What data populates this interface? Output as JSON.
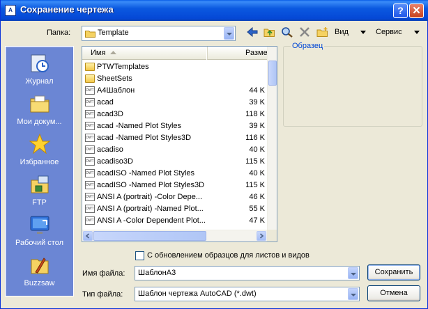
{
  "window": {
    "title": "Сохранение чертежа",
    "app_icon": "autocad-drawing-icon",
    "help_label": "?",
    "close_label": "✕"
  },
  "folder_label": "Папка:",
  "folder_value": "Template",
  "toolbar": {
    "icons": [
      "back-arrow-icon",
      "up-folder-icon",
      "search-web-icon",
      "delete-icon",
      "new-folder-icon"
    ],
    "view_label": "Вид",
    "service_label": "Сервис"
  },
  "places": [
    {
      "label": "Журнал",
      "icon": "history-icon"
    },
    {
      "label": "Мои докум...",
      "icon": "my-documents-icon"
    },
    {
      "label": "Избранное",
      "icon": "favorites-star-icon"
    },
    {
      "label": "FTP",
      "icon": "ftp-icon"
    },
    {
      "label": "Рабочий стол",
      "icon": "desktop-icon"
    },
    {
      "label": "Buzzsaw",
      "icon": "buzzsaw-icon"
    }
  ],
  "file_list": {
    "columns": {
      "name": "Имя",
      "size": "Разме"
    },
    "rows": [
      {
        "name": "PTWTemplates",
        "size": "",
        "type": "folder"
      },
      {
        "name": "SheetSets",
        "size": "",
        "type": "folder"
      },
      {
        "name": "A4Шаблон",
        "size": "44 K",
        "type": "dwg"
      },
      {
        "name": "acad",
        "size": "39 K",
        "type": "dwg"
      },
      {
        "name": "acad3D",
        "size": "118 K",
        "type": "dwg"
      },
      {
        "name": "acad -Named Plot Styles",
        "size": "39 K",
        "type": "dwg"
      },
      {
        "name": "acad -Named Plot Styles3D",
        "size": "116 K",
        "type": "dwg"
      },
      {
        "name": "acadiso",
        "size": "40 K",
        "type": "dwg"
      },
      {
        "name": "acadiso3D",
        "size": "115 K",
        "type": "dwg"
      },
      {
        "name": "acadISO -Named Plot Styles",
        "size": "40 K",
        "type": "dwg"
      },
      {
        "name": "acadISO -Named Plot Styles3D",
        "size": "115 K",
        "type": "dwg"
      },
      {
        "name": "ANSI A (portrait) -Color Depe...",
        "size": "46 K",
        "type": "dwg"
      },
      {
        "name": "ANSI A (portrait) -Named Plot...",
        "size": "55 K",
        "type": "dwg"
      },
      {
        "name": "ANSI A -Color Dependent Plot...",
        "size": "47 K",
        "type": "dwg"
      }
    ]
  },
  "preview_label": "Образец",
  "update_thumbnails_label": "С обновлением образцов для листов и видов",
  "filename_label": "Имя файла:",
  "filename_value": "ШаблонА3",
  "filetype_label": "Тип файла:",
  "filetype_value": "Шаблон чертежа AutoCAD (*.dwt)",
  "save_button": "Сохранить",
  "cancel_button": "Отмена"
}
